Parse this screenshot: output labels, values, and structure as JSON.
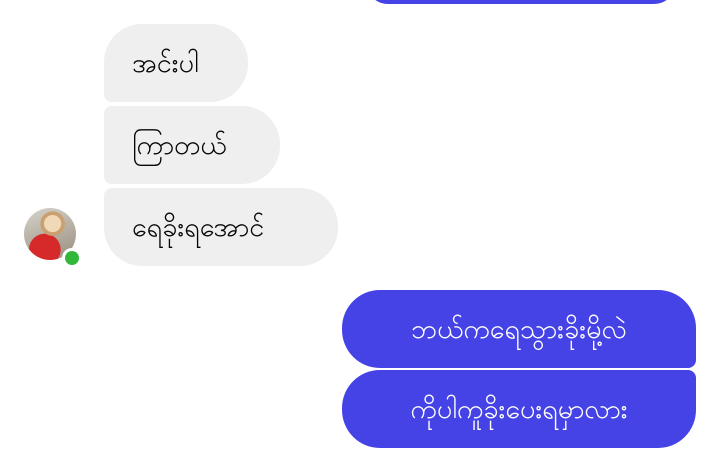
{
  "conversation": {
    "incoming": [
      "အင်းပါ",
      "ကြာတယ်",
      "ရေခိုးရအောင်"
    ],
    "outgoing": [
      "ဘယ်ကရေသွားခိုးမို့လဲ",
      "ကိုပါကူခိုးပေးရမှာလား"
    ]
  },
  "colors": {
    "incoming_bubble": "#efefef",
    "outgoing_bubble": "#4643e6",
    "online_status": "#31b83a"
  },
  "contact": {
    "online": true
  }
}
